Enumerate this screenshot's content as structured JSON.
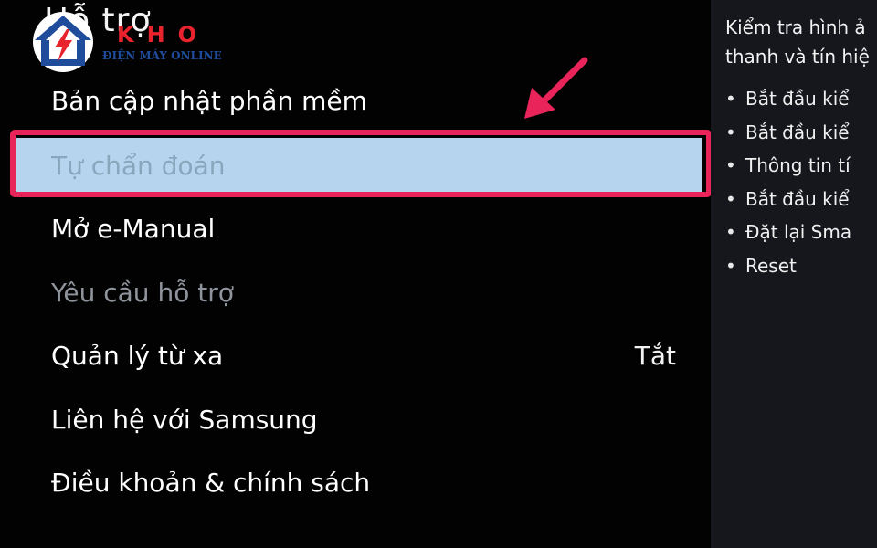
{
  "page_title": "Hỗ trợ",
  "menu": {
    "items": [
      {
        "label": "Bản cập nhật phần mềm",
        "value": "",
        "state": "normal"
      },
      {
        "label": "Tự chẩn đoán",
        "value": "",
        "state": "selected"
      },
      {
        "label": "Mở e-Manual",
        "value": "",
        "state": "normal"
      },
      {
        "label": "Yêu cầu hỗ trợ",
        "value": "",
        "state": "disabled"
      },
      {
        "label": "Quản lý từ xa",
        "value": "Tắt",
        "state": "normal"
      },
      {
        "label": "Liên hệ với Samsung",
        "value": "",
        "state": "normal"
      },
      {
        "label": "Điều khoản & chính sách",
        "value": "",
        "state": "normal"
      }
    ]
  },
  "side_panel": {
    "heading_line1": "Kiểm tra hình ả",
    "heading_line2": "thanh và tín hiệ",
    "items": [
      "Bắt đầu kiể",
      "Bắt đầu kiể",
      "Thông tin tí",
      "Bắt đầu kiể",
      "Đặt lại Sma",
      "Reset"
    ]
  },
  "watermark": {
    "brand": "KHO",
    "tagline": "ĐIỆN MÁY ONLINE",
    "icon": "house-lightning-icon"
  },
  "annotation": {
    "arrow_icon": "pointer-arrow-icon",
    "highlight_color": "#e8245a"
  },
  "colors": {
    "selected_background": "#b7d4ee",
    "selected_text": "#8aa6bd",
    "side_panel_background": "#15171d"
  }
}
